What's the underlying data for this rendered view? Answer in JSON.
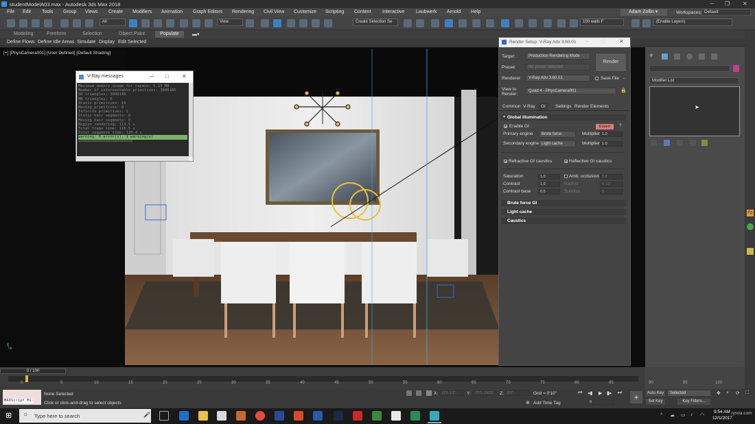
{
  "window": {
    "title": "studentModelA03.max - Autodesk 3ds Max 2018"
  },
  "menu": [
    "File",
    "Edit",
    "Tools",
    "Group",
    "Views",
    "Create",
    "Modifiers",
    "Animation",
    "Graph Editors",
    "Rendering",
    "Civil View",
    "Customize",
    "Scripting",
    "Content",
    "Interactive",
    "Laubwerk",
    "Arnold",
    "Help"
  ],
  "user": {
    "name": "Adam Zollin"
  },
  "workspace": {
    "label": "Workspaces:",
    "value": "Default"
  },
  "toolbar": {
    "filter": "All",
    "view": "View",
    "selection_set": "Create Selection Se",
    "walls": "100  walls F",
    "layers": "(Enable Layers)"
  },
  "ribbon": {
    "tabs": [
      "Modeling",
      "Freeform",
      "Selection",
      "Object Paint",
      "Populate"
    ],
    "subtabs": [
      "Define Flows",
      "Define Idle Areas",
      "Simulate",
      "Display",
      "Edit Selected"
    ]
  },
  "viewport": {
    "label": "[+] [PhysCamera001] [User Defined] [Default Shading]"
  },
  "vray_messages": {
    "title": "V-Ray messages",
    "lines": [
      "Maximum memory usage for raymon: 5.23 MB",
      "Number of intersectable primitives: 3900165",
      "  SD triangles: 3900148",
      "  MB triangles: 0",
      "  Static primitives: 16",
      "  Moving primitives: 0",
      "  Infinite primitives: 1",
      "  Static hair segments: 0",
      "  Moving hair segments: 0",
      "Region rendering: 113.5 s",
      "Total frame time: 116.5 s",
      "Total sequence time: 120.4 s"
    ],
    "warning": "warning: 0 error(s), 1 warning(s)",
    "separator": "========================"
  },
  "render_setup": {
    "title": "Render Setup: V-Ray Adv 3.60.01",
    "target_label": "Target:",
    "target": "Production Rendering Mode",
    "preset_label": "Preset:",
    "preset": "No preset selected",
    "renderer_label": "Renderer:",
    "renderer": "V-Ray Adv 3.60.01",
    "save_file": "Save File",
    "view_label": "View to Render:",
    "view": "Quad 4 - PhysCamera001",
    "render_button": "Render",
    "tabs": [
      "Common",
      "V-Ray",
      "GI",
      "Settings",
      "Render Elements"
    ],
    "gi_section": "Global illumination",
    "expert": "Expert",
    "enable_gi": "Enable GI",
    "primary_label": "Primary engine",
    "primary": "Brute force",
    "primary_mult": "1.0",
    "secondary_label": "Secondary engine",
    "secondary": "Light cache",
    "secondary_mult": "1.0",
    "multiplier": "Multiplier",
    "refractive": "Refractive GI caustics",
    "reflective": "Reflective GI caustics",
    "saturation_label": "Saturation",
    "saturation": "1.0",
    "contrast_label": "Contrast",
    "contrast": "1.0",
    "contrast_base_label": "Contrast base",
    "contrast_base": "0.5",
    "amb_occlusion": "Amb. occlusion",
    "amb_value": "0.8",
    "radius": "Radius",
    "radius_value": "0' 10\"",
    "subdivs": "Subdivs",
    "subdivs_value": "8",
    "rollouts": [
      "Brute force GI",
      "Light cache",
      "Caustics"
    ]
  },
  "command_panel": {
    "modifier_list": "Modifier List"
  },
  "timeline": {
    "frame": "0 / 100",
    "ticks": [
      "0",
      "5",
      "10",
      "15",
      "20",
      "25",
      "30",
      "35",
      "40",
      "45",
      "50",
      "55",
      "60",
      "65",
      "70",
      "75",
      "80",
      "85",
      "90",
      "95",
      "100"
    ]
  },
  "status": {
    "maxscript": "MAXScript Mi:",
    "selection": "None Selected",
    "prompt": "Click or click-and-drag to select objects",
    "x_label": "X:",
    "x": "97'6 1/2\"",
    "y_label": "Y:",
    "y": "-76'5 29/32",
    "z_label": "Z:",
    "z": "0'0\"",
    "grid": "Grid = 0'10\"",
    "add_time_tag": "Add Time Tag",
    "frame_field": "0",
    "auto_key": "Auto Key",
    "set_key": "Set Key",
    "key_mode": "Selected",
    "key_filters": "Key Filters..."
  },
  "taskbar": {
    "search": "Type here to search",
    "time": "9:54 AM",
    "date": "12/1/2017",
    "watermark": "lynda.com"
  },
  "colors": {
    "accent": "#3f7fbf",
    "warning_green": "#7cb36a",
    "expert_pink": "#e07a7a",
    "swatch_magenta": "#c0408a"
  }
}
